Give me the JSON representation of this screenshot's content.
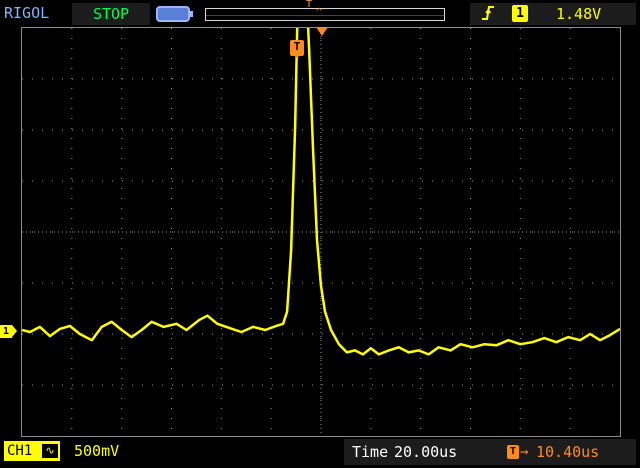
{
  "header": {
    "brand": "RIGOL",
    "run_state": "STOP",
    "memory_trigger_marker": "T",
    "trigger": {
      "edge_icon": "rising-edge-icon",
      "source_channel": "1",
      "level": "1.48V"
    }
  },
  "screen": {
    "trigger_marker": "T",
    "channel_marker": "1",
    "colors": {
      "trace": "#ffff00",
      "trigger": "#ff8a1e",
      "grid": "#9a9a9a",
      "status_green": "#00ff52"
    },
    "trace": {
      "name": "CH1",
      "points": [
        [
          0,
          0.02
        ],
        [
          8,
          0.0
        ],
        [
          18,
          0.05
        ],
        [
          28,
          -0.04
        ],
        [
          38,
          0.03
        ],
        [
          48,
          0.06
        ],
        [
          58,
          -0.02
        ],
        [
          70,
          -0.08
        ],
        [
          80,
          0.05
        ],
        [
          90,
          0.1
        ],
        [
          100,
          0.02
        ],
        [
          110,
          -0.05
        ],
        [
          120,
          0.02
        ],
        [
          130,
          0.1
        ],
        [
          142,
          0.05
        ],
        [
          155,
          0.08
        ],
        [
          165,
          0.02
        ],
        [
          178,
          0.12
        ],
        [
          186,
          0.16
        ],
        [
          196,
          0.08
        ],
        [
          208,
          0.04
        ],
        [
          220,
          0.0
        ],
        [
          232,
          0.05
        ],
        [
          244,
          0.02
        ],
        [
          255,
          0.06
        ],
        [
          262,
          0.08
        ],
        [
          266,
          0.2
        ],
        [
          270,
          0.8
        ],
        [
          274,
          2.0
        ],
        [
          277,
          3.4
        ],
        [
          279,
          3.8
        ],
        [
          281,
          3.9
        ],
        [
          284,
          3.6
        ],
        [
          288,
          2.8
        ],
        [
          292,
          1.8
        ],
        [
          296,
          0.9
        ],
        [
          300,
          0.45
        ],
        [
          304,
          0.2
        ],
        [
          310,
          0.02
        ],
        [
          318,
          -0.12
        ],
        [
          326,
          -0.2
        ],
        [
          334,
          -0.18
        ],
        [
          342,
          -0.22
        ],
        [
          350,
          -0.16
        ],
        [
          358,
          -0.22
        ],
        [
          368,
          -0.18
        ],
        [
          378,
          -0.15
        ],
        [
          388,
          -0.2
        ],
        [
          398,
          -0.18
        ],
        [
          408,
          -0.22
        ],
        [
          418,
          -0.15
        ],
        [
          430,
          -0.18
        ],
        [
          440,
          -0.12
        ],
        [
          452,
          -0.15
        ],
        [
          464,
          -0.12
        ],
        [
          476,
          -0.13
        ],
        [
          488,
          -0.08
        ],
        [
          500,
          -0.12
        ],
        [
          512,
          -0.1
        ],
        [
          524,
          -0.06
        ],
        [
          536,
          -0.1
        ],
        [
          548,
          -0.05
        ],
        [
          560,
          -0.08
        ],
        [
          570,
          -0.02
        ],
        [
          580,
          -0.08
        ],
        [
          590,
          -0.03
        ],
        [
          600,
          0.03
        ]
      ]
    }
  },
  "footer": {
    "channel_label": "CH1",
    "coupling_icon": "ac-coupling-icon",
    "vertical_scale": "500mV",
    "time_label": "Time",
    "time_scale": "20.00us",
    "offset_marker": "T",
    "offset_arrow": "→",
    "horizontal_offset": "10.40us"
  }
}
